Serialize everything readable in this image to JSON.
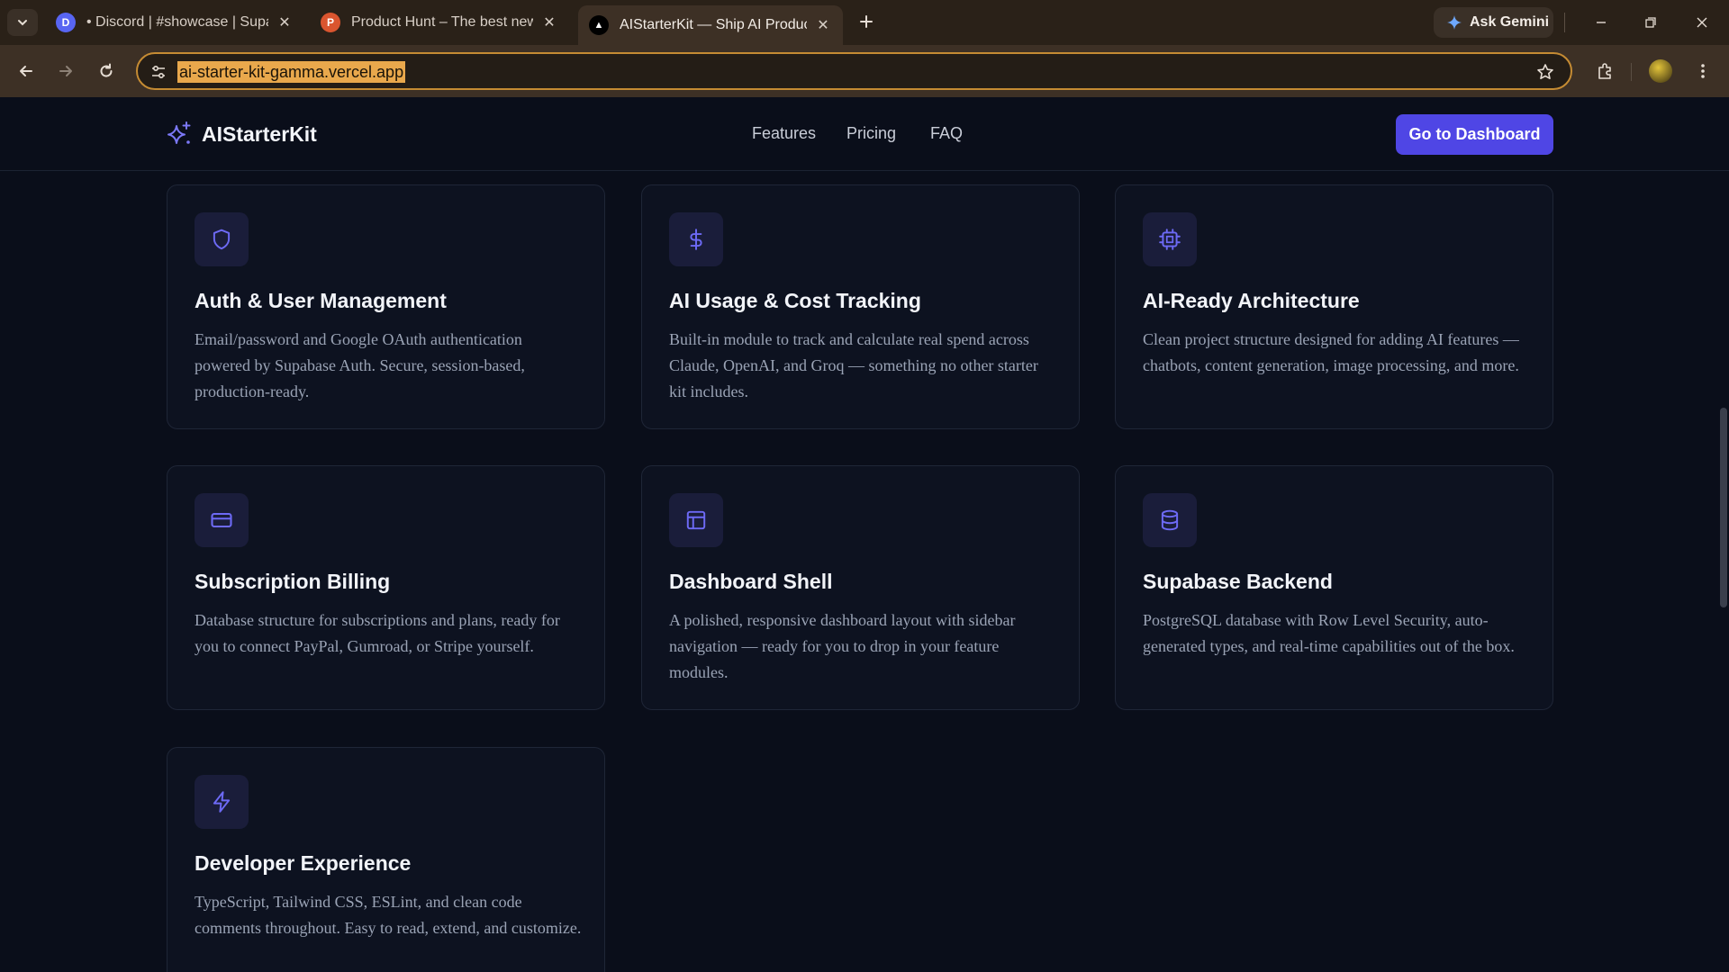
{
  "browser": {
    "tabs": [
      {
        "title": "• Discord | #showcase | Supabase",
        "favicon": "D",
        "color": "#5865f2"
      },
      {
        "title": "Product Hunt – The best new products",
        "favicon": "P",
        "color": "#da552f"
      },
      {
        "title": "AIStarterKit — Ship AI Products",
        "favicon": "▲",
        "color": "#000000"
      }
    ],
    "gemini_label": "Ask Gemini",
    "url": "ai-starter-kit-gamma.vercel.app"
  },
  "site": {
    "brand": "AIStarterKit",
    "nav": [
      "Features",
      "Pricing",
      "FAQ"
    ],
    "cta": "Go to Dashboard",
    "accent": "#4f46e5",
    "icon_color": "#6d6af5"
  },
  "features": [
    {
      "icon": "shield-icon",
      "title": "Auth & User Management",
      "desc": "Email/password and Google OAuth authentication powered by Supabase Auth. Secure, session-based, production-ready."
    },
    {
      "icon": "dollar-icon",
      "title": "AI Usage & Cost Tracking",
      "desc": "Built-in module to track and calculate real spend across Claude, OpenAI, and Groq — something no other starter kit includes."
    },
    {
      "icon": "cpu-icon",
      "title": "AI-Ready Architecture",
      "desc": "Clean project structure designed for adding AI features — chatbots, content generation, image processing, and more."
    },
    {
      "icon": "credit-card-icon",
      "title": "Subscription Billing",
      "desc": "Database structure for subscriptions and plans, ready for you to connect PayPal, Gumroad, or Stripe yourself."
    },
    {
      "icon": "layout-icon",
      "title": "Dashboard Shell",
      "desc": "A polished, responsive dashboard layout with sidebar navigation — ready for you to drop in your feature modules."
    },
    {
      "icon": "database-icon",
      "title": "Supabase Backend",
      "desc": "PostgreSQL database with Row Level Security, auto-generated types, and real-time capabilities out of the box."
    },
    {
      "icon": "zap-icon",
      "title": "Developer Experience",
      "desc": "TypeScript, Tailwind CSS, ESLint, and clean code comments throughout. Easy to read, extend, and customize."
    }
  ]
}
